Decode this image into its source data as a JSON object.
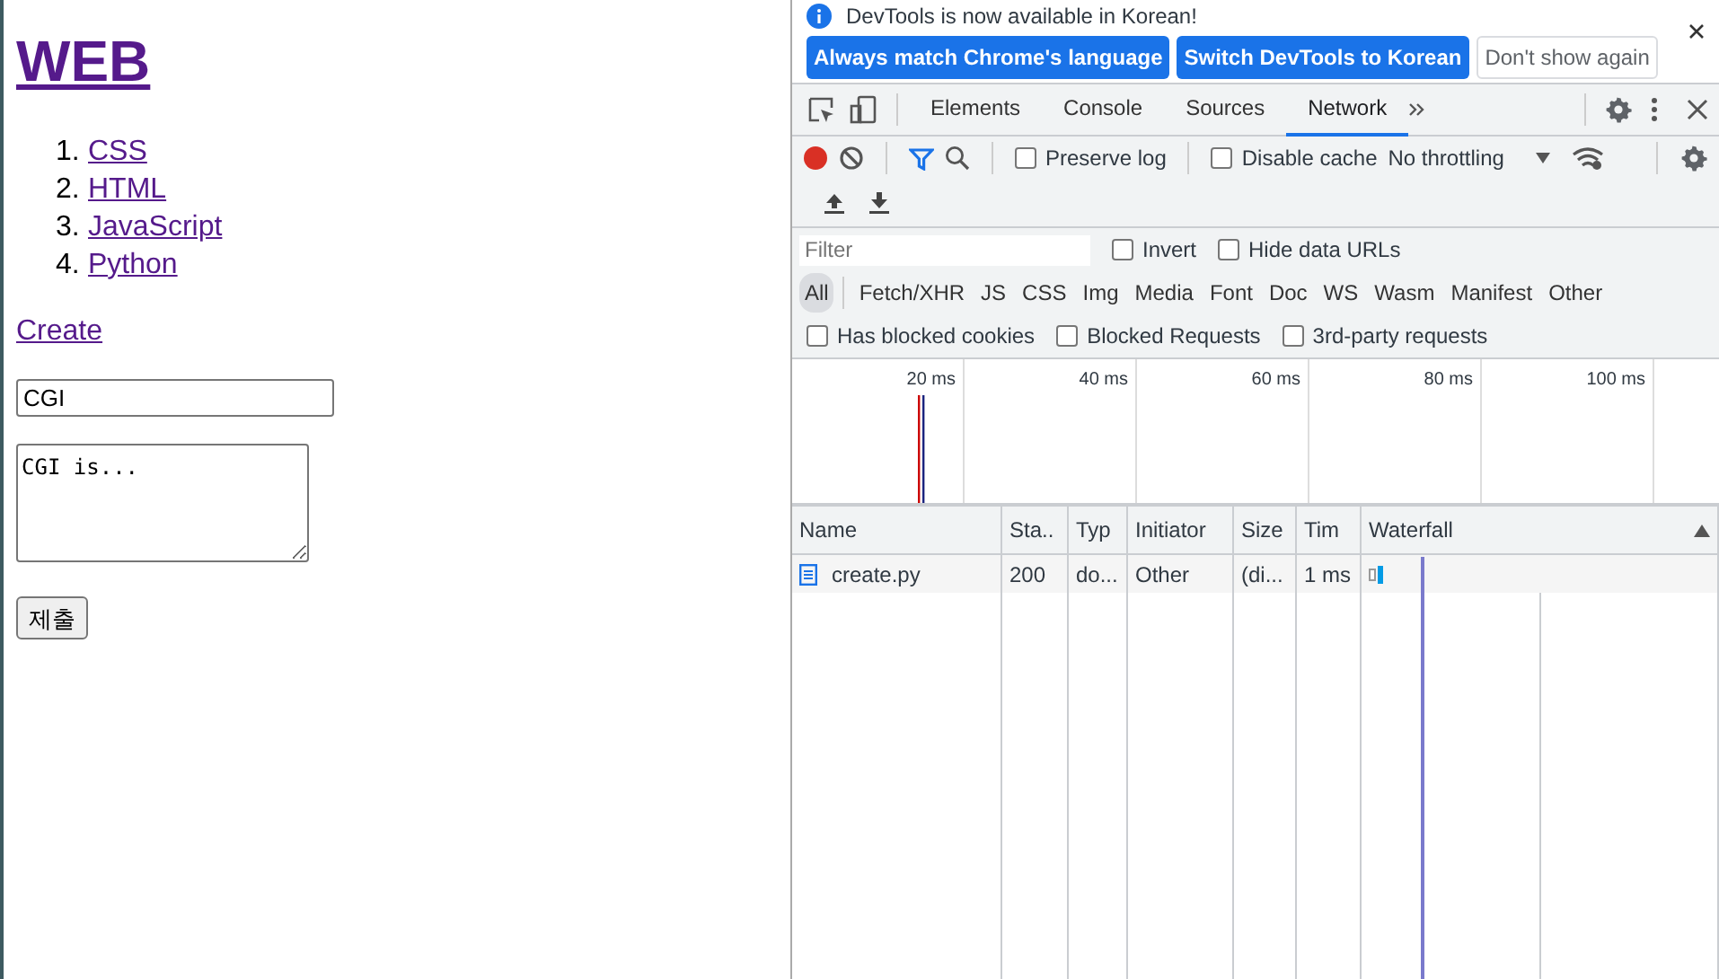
{
  "page": {
    "title": "WEB",
    "topics": [
      {
        "marker": "1.",
        "label": "CSS"
      },
      {
        "marker": "2.",
        "label": "HTML"
      },
      {
        "marker": "3.",
        "label": "JavaScript"
      },
      {
        "marker": "4.",
        "label": "Python"
      }
    ],
    "create_link": "Create",
    "title_field": {
      "value": "CGI"
    },
    "description_field": {
      "value": "CGI is..."
    },
    "submit_button": "제출"
  },
  "devtools": {
    "infobar": {
      "message": "DevTools is now available in Korean!",
      "buttons": [
        {
          "label": "Always match Chrome's language",
          "kind": "primary"
        },
        {
          "label": "Switch DevTools to Korean",
          "kind": "primary"
        },
        {
          "label": "Don't show again",
          "kind": "secondary"
        }
      ]
    },
    "tabs": [
      {
        "label": "Elements",
        "selected": false
      },
      {
        "label": "Console",
        "selected": false
      },
      {
        "label": "Sources",
        "selected": false
      },
      {
        "label": "Network",
        "selected": true
      }
    ],
    "toolbar": {
      "recording": true,
      "checkboxes": [
        {
          "label": "Preserve log",
          "checked": false
        },
        {
          "label": "Disable cache",
          "checked": false
        }
      ],
      "throttling": "No throttling"
    },
    "filter": {
      "placeholder": "Filter",
      "options": [
        {
          "label": "Invert",
          "checked": false
        },
        {
          "label": "Hide data URLs",
          "checked": false
        }
      ]
    },
    "type_filters": [
      {
        "label": "All",
        "selected": true
      },
      {
        "label": "Fetch/XHR",
        "selected": false
      },
      {
        "label": "JS",
        "selected": false
      },
      {
        "label": "CSS",
        "selected": false
      },
      {
        "label": "Img",
        "selected": false
      },
      {
        "label": "Media",
        "selected": false
      },
      {
        "label": "Font",
        "selected": false
      },
      {
        "label": "Doc",
        "selected": false
      },
      {
        "label": "WS",
        "selected": false
      },
      {
        "label": "Wasm",
        "selected": false
      },
      {
        "label": "Manifest",
        "selected": false
      },
      {
        "label": "Other",
        "selected": false
      }
    ],
    "more_options": [
      {
        "label": "Has blocked cookies",
        "checked": false
      },
      {
        "label": "Blocked Requests",
        "checked": false
      },
      {
        "label": "3rd-party requests",
        "checked": false
      }
    ],
    "overview": {
      "ticks": [
        "20 ms",
        "40 ms",
        "60 ms",
        "80 ms",
        "100 ms"
      ]
    },
    "table": {
      "columns": [
        "Name",
        "Sta..",
        "Typ",
        "Initiator",
        "Size",
        "Tim",
        "Waterfall"
      ],
      "rows": [
        {
          "cells": [
            "create.py",
            "200",
            "do...",
            "Other",
            "(di...",
            "1 ms"
          ]
        }
      ]
    }
  }
}
